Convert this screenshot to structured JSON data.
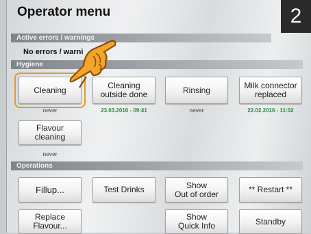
{
  "header": {
    "title": "Operator menu",
    "step_badge": "2"
  },
  "errors": {
    "section_label": "Active errors / warnings",
    "status_text": "No errors / warni"
  },
  "hygiene": {
    "section_label": "Hygiene",
    "buttons": [
      {
        "label": "Cleaning",
        "caption": "never"
      },
      {
        "label": "Cleaning\noutside done",
        "caption": "23.03.2016 - 09:41"
      },
      {
        "label": "Rinsing",
        "caption": "never"
      },
      {
        "label": "Milk connector\nreplaced",
        "caption": "22.02.2016 - 11:02"
      },
      {
        "label": "Flavour\ncleaning",
        "caption": "never"
      }
    ]
  },
  "operations": {
    "section_label": "Operations",
    "buttons": [
      {
        "label": "Fillup..."
      },
      {
        "label": "Test Drinks"
      },
      {
        "label": "Show\nOut of order"
      },
      {
        "label": "** Restart **"
      },
      {
        "label": "Replace\nFlavour..."
      },
      {
        "label": "Show\nQuick Info"
      },
      {
        "label": "Standby"
      }
    ]
  },
  "colors": {
    "highlight": "#e9962e",
    "date_caption": "#2e8b3e",
    "never_caption": "#666666"
  },
  "icons": {
    "pointer": "pointing-hand-icon"
  }
}
